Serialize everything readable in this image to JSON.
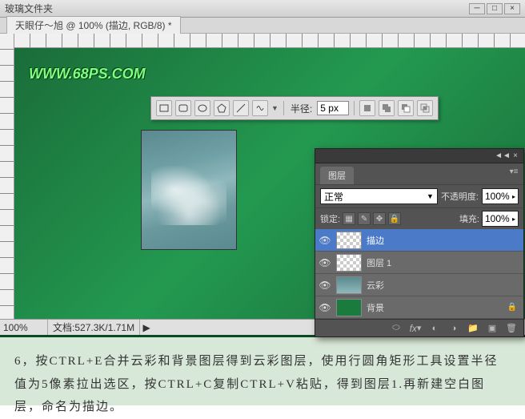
{
  "titlebar": {
    "icon_label": "玻璃文件夹"
  },
  "tab": {
    "label": "天眼仔～旭 @ 100% (描边, RGB/8) *"
  },
  "watermark": "WWW.68PS.COM",
  "shape_toolbar": {
    "radius_label": "半径:",
    "radius_value": "5 px"
  },
  "layers_panel": {
    "tab": "图层",
    "blend_mode": "正常",
    "opacity_label": "不透明度:",
    "opacity_value": "100%",
    "lock_label": "锁定:",
    "fill_label": "填充:",
    "fill_value": "100%",
    "layers": [
      {
        "name": "描边",
        "selected": true,
        "thumb": "checker"
      },
      {
        "name": "图层 1",
        "selected": false,
        "thumb": "checker"
      },
      {
        "name": "云彩",
        "selected": false,
        "thumb": "cloud"
      },
      {
        "name": "背景",
        "selected": false,
        "thumb": "bg"
      }
    ]
  },
  "statusbar": {
    "zoom": "100%",
    "doc_label": "文档:",
    "doc_value": "527.3K/1.71M"
  },
  "instruction": "6，按CTRL+E合并云彩和背景图层得到云彩图层，使用行圆角矩形工具设置半径值为5像素拉出选区，按CTRL+C复制CTRL+V粘贴，得到图层1.再新建空白图层，命名为描边。"
}
